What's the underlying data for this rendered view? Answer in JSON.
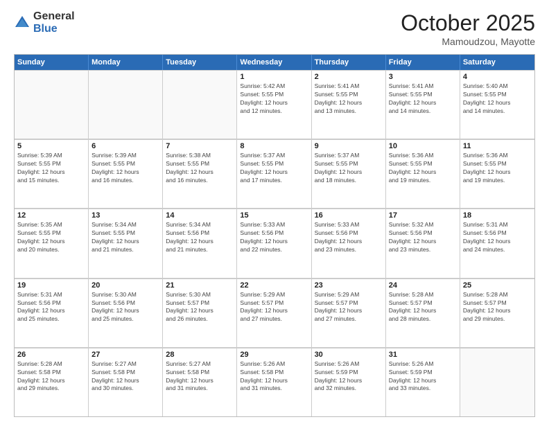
{
  "logo": {
    "general": "General",
    "blue": "Blue"
  },
  "title": "October 2025",
  "location": "Mamoudzou, Mayotte",
  "days_of_week": [
    "Sunday",
    "Monday",
    "Tuesday",
    "Wednesday",
    "Thursday",
    "Friday",
    "Saturday"
  ],
  "weeks": [
    [
      {
        "num": "",
        "info": ""
      },
      {
        "num": "",
        "info": ""
      },
      {
        "num": "",
        "info": ""
      },
      {
        "num": "1",
        "info": "Sunrise: 5:42 AM\nSunset: 5:55 PM\nDaylight: 12 hours\nand 12 minutes."
      },
      {
        "num": "2",
        "info": "Sunrise: 5:41 AM\nSunset: 5:55 PM\nDaylight: 12 hours\nand 13 minutes."
      },
      {
        "num": "3",
        "info": "Sunrise: 5:41 AM\nSunset: 5:55 PM\nDaylight: 12 hours\nand 14 minutes."
      },
      {
        "num": "4",
        "info": "Sunrise: 5:40 AM\nSunset: 5:55 PM\nDaylight: 12 hours\nand 14 minutes."
      }
    ],
    [
      {
        "num": "5",
        "info": "Sunrise: 5:39 AM\nSunset: 5:55 PM\nDaylight: 12 hours\nand 15 minutes."
      },
      {
        "num": "6",
        "info": "Sunrise: 5:39 AM\nSunset: 5:55 PM\nDaylight: 12 hours\nand 16 minutes."
      },
      {
        "num": "7",
        "info": "Sunrise: 5:38 AM\nSunset: 5:55 PM\nDaylight: 12 hours\nand 16 minutes."
      },
      {
        "num": "8",
        "info": "Sunrise: 5:37 AM\nSunset: 5:55 PM\nDaylight: 12 hours\nand 17 minutes."
      },
      {
        "num": "9",
        "info": "Sunrise: 5:37 AM\nSunset: 5:55 PM\nDaylight: 12 hours\nand 18 minutes."
      },
      {
        "num": "10",
        "info": "Sunrise: 5:36 AM\nSunset: 5:55 PM\nDaylight: 12 hours\nand 19 minutes."
      },
      {
        "num": "11",
        "info": "Sunrise: 5:36 AM\nSunset: 5:55 PM\nDaylight: 12 hours\nand 19 minutes."
      }
    ],
    [
      {
        "num": "12",
        "info": "Sunrise: 5:35 AM\nSunset: 5:55 PM\nDaylight: 12 hours\nand 20 minutes."
      },
      {
        "num": "13",
        "info": "Sunrise: 5:34 AM\nSunset: 5:55 PM\nDaylight: 12 hours\nand 21 minutes."
      },
      {
        "num": "14",
        "info": "Sunrise: 5:34 AM\nSunset: 5:56 PM\nDaylight: 12 hours\nand 21 minutes."
      },
      {
        "num": "15",
        "info": "Sunrise: 5:33 AM\nSunset: 5:56 PM\nDaylight: 12 hours\nand 22 minutes."
      },
      {
        "num": "16",
        "info": "Sunrise: 5:33 AM\nSunset: 5:56 PM\nDaylight: 12 hours\nand 23 minutes."
      },
      {
        "num": "17",
        "info": "Sunrise: 5:32 AM\nSunset: 5:56 PM\nDaylight: 12 hours\nand 23 minutes."
      },
      {
        "num": "18",
        "info": "Sunrise: 5:31 AM\nSunset: 5:56 PM\nDaylight: 12 hours\nand 24 minutes."
      }
    ],
    [
      {
        "num": "19",
        "info": "Sunrise: 5:31 AM\nSunset: 5:56 PM\nDaylight: 12 hours\nand 25 minutes."
      },
      {
        "num": "20",
        "info": "Sunrise: 5:30 AM\nSunset: 5:56 PM\nDaylight: 12 hours\nand 25 minutes."
      },
      {
        "num": "21",
        "info": "Sunrise: 5:30 AM\nSunset: 5:57 PM\nDaylight: 12 hours\nand 26 minutes."
      },
      {
        "num": "22",
        "info": "Sunrise: 5:29 AM\nSunset: 5:57 PM\nDaylight: 12 hours\nand 27 minutes."
      },
      {
        "num": "23",
        "info": "Sunrise: 5:29 AM\nSunset: 5:57 PM\nDaylight: 12 hours\nand 27 minutes."
      },
      {
        "num": "24",
        "info": "Sunrise: 5:28 AM\nSunset: 5:57 PM\nDaylight: 12 hours\nand 28 minutes."
      },
      {
        "num": "25",
        "info": "Sunrise: 5:28 AM\nSunset: 5:57 PM\nDaylight: 12 hours\nand 29 minutes."
      }
    ],
    [
      {
        "num": "26",
        "info": "Sunrise: 5:28 AM\nSunset: 5:58 PM\nDaylight: 12 hours\nand 29 minutes."
      },
      {
        "num": "27",
        "info": "Sunrise: 5:27 AM\nSunset: 5:58 PM\nDaylight: 12 hours\nand 30 minutes."
      },
      {
        "num": "28",
        "info": "Sunrise: 5:27 AM\nSunset: 5:58 PM\nDaylight: 12 hours\nand 31 minutes."
      },
      {
        "num": "29",
        "info": "Sunrise: 5:26 AM\nSunset: 5:58 PM\nDaylight: 12 hours\nand 31 minutes."
      },
      {
        "num": "30",
        "info": "Sunrise: 5:26 AM\nSunset: 5:59 PM\nDaylight: 12 hours\nand 32 minutes."
      },
      {
        "num": "31",
        "info": "Sunrise: 5:26 AM\nSunset: 5:59 PM\nDaylight: 12 hours\nand 33 minutes."
      },
      {
        "num": "",
        "info": ""
      }
    ]
  ]
}
